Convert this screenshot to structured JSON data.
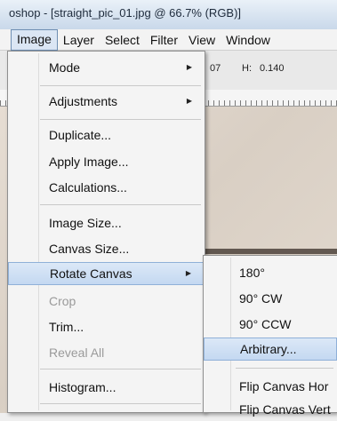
{
  "window": {
    "title": "oshop - [straight_pic_01.jpg @ 66.7% (RGB)]"
  },
  "menubar": {
    "items": [
      "Image",
      "Layer",
      "Select",
      "Filter",
      "View",
      "Window"
    ]
  },
  "options": {
    "w_fragment": "07",
    "h_label": "H:",
    "h_value": "0.140"
  },
  "image_menu": {
    "mode": "Mode",
    "adjustments": "Adjustments",
    "duplicate": "Duplicate...",
    "apply_image": "Apply Image...",
    "calculations": "Calculations...",
    "image_size": "Image Size...",
    "canvas_size": "Canvas Size...",
    "rotate_canvas": "Rotate Canvas",
    "crop": "Crop",
    "trim": "Trim...",
    "reveal_all": "Reveal All",
    "histogram": "Histogram..."
  },
  "rotate_submenu": {
    "r180": "180°",
    "cw": "90° CW",
    "ccw": "90° CCW",
    "arbitrary": "Arbitrary...",
    "flip_h": "Flip Canvas Hor",
    "flip_v": "Flip Canvas Vert"
  }
}
